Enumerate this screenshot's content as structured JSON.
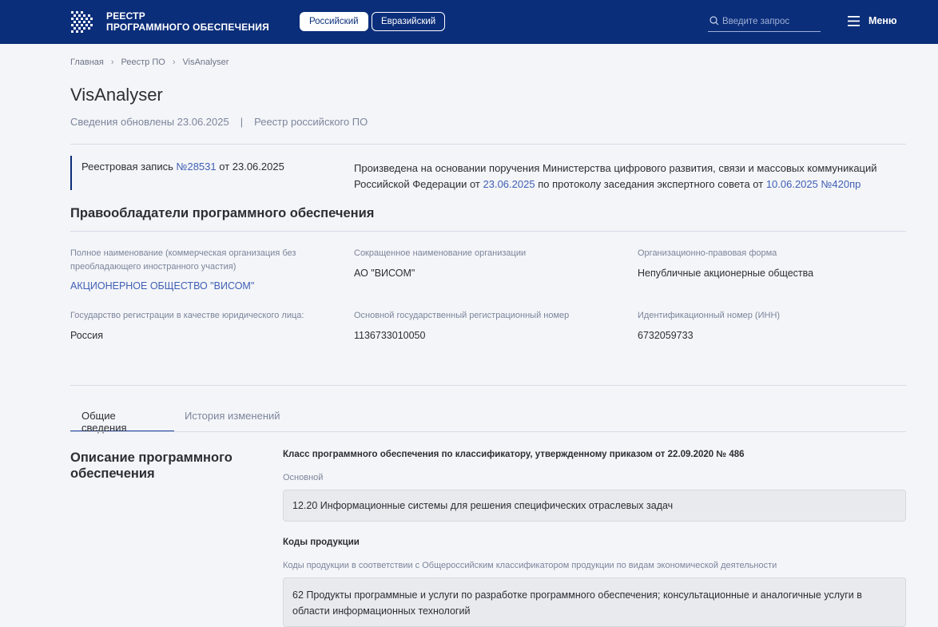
{
  "header": {
    "logo_line1": "РЕЕСТР",
    "logo_line2": "ПРОГРАММНОГО ОБЕСПЕЧЕНИЯ",
    "registry_russian": "Российский",
    "registry_eurasian": "Евразийский",
    "search_placeholder": "Введите запрос",
    "menu_label": "Меню"
  },
  "breadcrumb": [
    "Главная",
    "Реестр ПО",
    "VisAnalyser"
  ],
  "page": {
    "title": "VisAnalyser",
    "updated": "Сведения обновлены 23.06.2025",
    "separator": "|",
    "registry_type": "Реестр российского ПО"
  },
  "record": {
    "prefix": "Реестровая запись",
    "number": "№28531",
    "date_text": "от 23.06.2025",
    "basis_part1": "Произведена на основании поручения Министерства цифрового развития, связи и массовых коммуникаций Российской Федерации от",
    "basis_date1": "23.06.2025",
    "basis_part2": "по протоколу заседания экспертного совета от",
    "basis_date2": "10.06.2025 №420пр"
  },
  "owners": {
    "heading": "Правообладатели программного обеспечения",
    "fields": [
      {
        "label": "Полное наименование (коммерческая организация без преобладающего иностранного участия)",
        "value": "АКЦИОНЕРНОЕ ОБЩЕСТВО \"ВИСОМ\""
      },
      {
        "label": "Сокращенное наименование организации",
        "value": "АО \"ВИСОМ\""
      },
      {
        "label": "Организационно-правовая форма",
        "value": "Непубличные акционерные общества"
      },
      {
        "label": "Государство регистрации в качестве юридического лица:",
        "value": "Россия"
      },
      {
        "label": "Основной государственный регистрационный номер",
        "value": "1136733010050"
      },
      {
        "label": "Идентификационный номер (ИНН)",
        "value": "6732059733"
      }
    ]
  },
  "tabs": [
    "Общие сведения",
    "История изменений"
  ],
  "description": {
    "title": "Описание программного обеспечения",
    "class_label": "Класс программного обеспечения по классификатору, утвержденному приказом от 22.09.2020 № 486",
    "main_label": "Основной",
    "main_value": "12.20 Информационные системы для решения специфических отраслевых задач",
    "codes_label": "Коды продукции",
    "codes_sub_label": "Коды продукции в соответствии с Общероссийским классификатором продукции по видам экономической деятельности",
    "codes_value": "62 Продукты программные и услуги по разработке программного обеспечения; консультационные и аналогичные услуги в области информационных технологий"
  }
}
